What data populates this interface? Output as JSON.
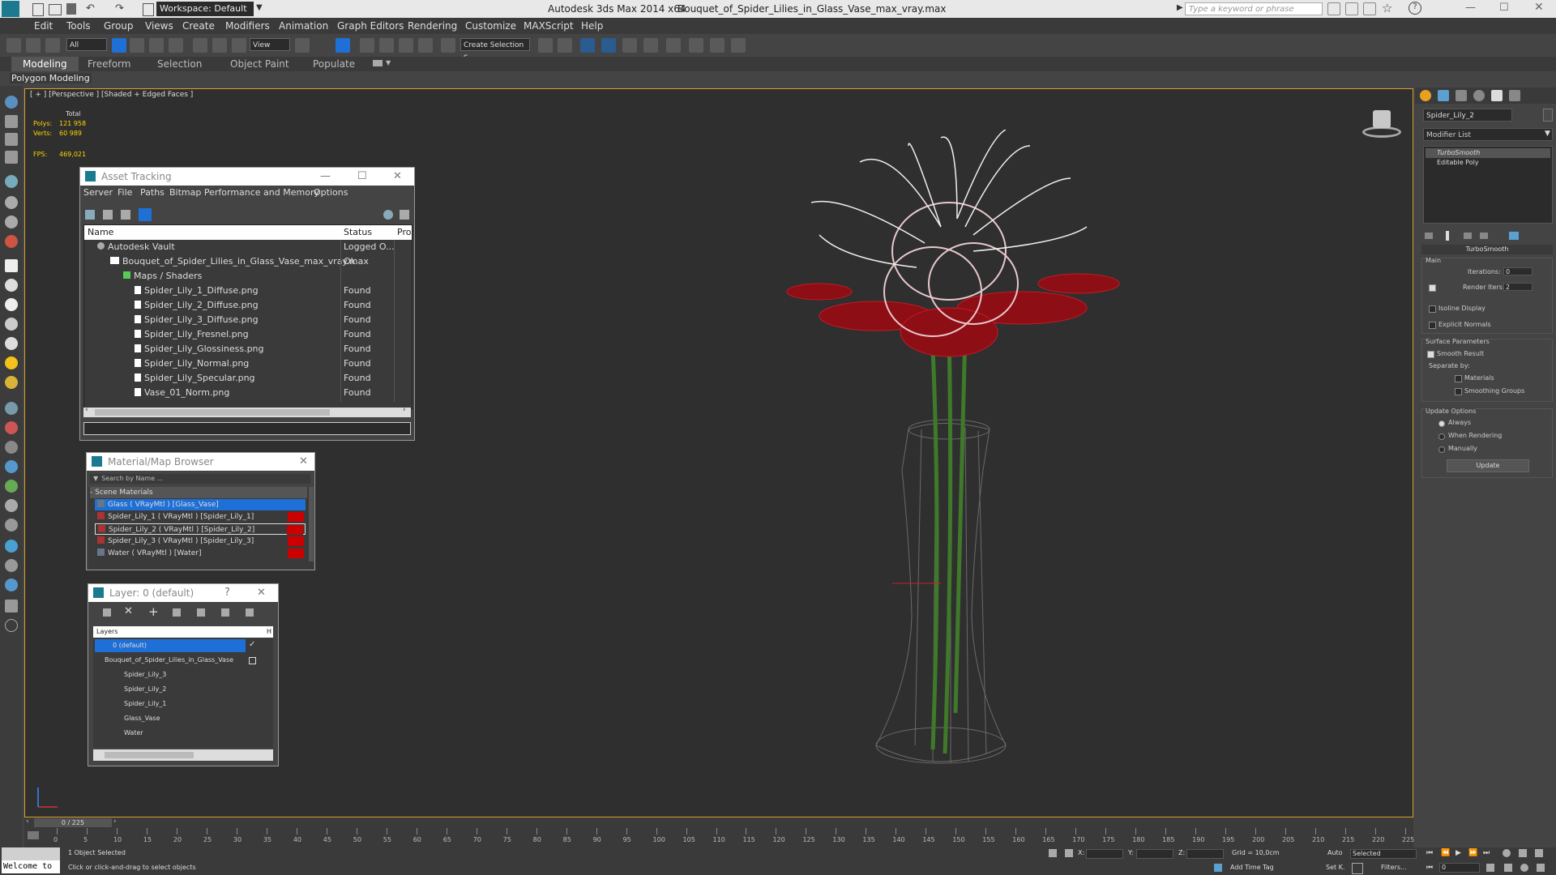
{
  "title_bar": {
    "workspace": "Workspace: Default",
    "app_title": "Autodesk 3ds Max  2014 x64",
    "file_title": "Bouquet_of_Spider_Lilies_in_Glass_Vase_max_vray.max",
    "search_placeholder": "Type a keyword or phrase"
  },
  "menu": [
    "Edit",
    "Tools",
    "Group",
    "Views",
    "Create",
    "Modifiers",
    "Animation",
    "Graph Editors",
    "Rendering",
    "Customize",
    "MAXScript",
    "Help"
  ],
  "toolbar": {
    "selection_filter": "All",
    "ref_coord": "View",
    "named_selection": "Create Selection S"
  },
  "ribbon": {
    "tabs": [
      "Modeling",
      "Freeform",
      "Selection",
      "Object Paint",
      "Populate"
    ],
    "sub_label": "Polygon Modeling"
  },
  "viewport": {
    "label": "[ + ] [Perspective ] [Shaded + Edged Faces ]",
    "stats_total": "Total",
    "polys_label": "Polys:",
    "polys_value": "121 958",
    "verts_label": "Verts:",
    "verts_value": "60 989",
    "fps_label": "FPS:",
    "fps_value": "469,021"
  },
  "asset_tracking": {
    "title": "Asset Tracking",
    "menu": [
      "Server",
      "File",
      "Paths",
      "Bitmap Performance and Memory",
      "Options"
    ],
    "columns": [
      "Name",
      "Status",
      "Pro:"
    ],
    "rows": [
      {
        "name": "Autodesk Vault",
        "status": "Logged O..."
      },
      {
        "name": "Bouquet_of_Spider_Lilies_in_Glass_Vase_max_vray.max",
        "status": "Ok"
      },
      {
        "name": "Maps / Shaders",
        "status": ""
      },
      {
        "name": "Spider_Lily_1_Diffuse.png",
        "status": "Found"
      },
      {
        "name": "Spider_Lily_2_Diffuse.png",
        "status": "Found"
      },
      {
        "name": "Spider_Lily_3_Diffuse.png",
        "status": "Found"
      },
      {
        "name": "Spider_Lily_Fresnel.png",
        "status": "Found"
      },
      {
        "name": "Spider_Lily_Glossiness.png",
        "status": "Found"
      },
      {
        "name": "Spider_Lily_Normal.png",
        "status": "Found"
      },
      {
        "name": "Spider_Lily_Specular.png",
        "status": "Found"
      },
      {
        "name": "Vase_01_Norm.png",
        "status": "Found"
      }
    ]
  },
  "material_browser": {
    "title": "Material/Map Browser",
    "search_placeholder": "Search by Name ...",
    "group": "- Scene Materials",
    "items": [
      "Glass  ( VRayMtl ) [Glass_Vase]",
      "Spider_Lily_1  ( VRayMtl ) [Spider_Lily_1]",
      "Spider_Lily_2  ( VRayMtl ) [Spider_Lily_2]",
      "Spider_Lily_3  ( VRayMtl ) [Spider_Lily_3]",
      "Water  ( VRayMtl ) [Water]"
    ]
  },
  "layer_window": {
    "title": "Layer: 0 (default)",
    "help": "?",
    "header": "Layers",
    "header_col": "H",
    "rows": [
      "0 (default)",
      "Bouquet_of_Spider_Lilies_in_Glass_Vase",
      "Spider_Lily_3",
      "Spider_Lily_2",
      "Spider_Lily_1",
      "Glass_Vase",
      "Water"
    ]
  },
  "command_panel": {
    "object_name": "Spider_Lily_2",
    "modifier_list": "Modifier List",
    "stack": [
      "TurboSmooth",
      "Editable Poly"
    ],
    "rollout_title": "TurboSmooth",
    "main_label": "Main",
    "iterations_label": "Iterations:",
    "iterations_value": "0",
    "render_iters_label": "Render Iters:",
    "render_iters_value": "2",
    "isoline": "Isoline Display",
    "explicit_normals": "Explicit Normals",
    "surface_params": "Surface Parameters",
    "smooth_result": "Smooth Result",
    "separate_by": "Separate by:",
    "materials": "Materials",
    "smoothing_groups": "Smoothing Groups",
    "update_options": "Update Options",
    "always": "Always",
    "when_rendering": "When Rendering",
    "manually": "Manually",
    "update_button": "Update"
  },
  "timeline": {
    "frame": "0 / 225",
    "ticks": [
      "0",
      "5",
      "10",
      "15",
      "20",
      "25",
      "30",
      "35",
      "40",
      "45",
      "50",
      "55",
      "60",
      "65",
      "70",
      "75",
      "80",
      "85",
      "90",
      "95",
      "100",
      "105",
      "110",
      "115",
      "120",
      "125",
      "130",
      "135",
      "140",
      "145",
      "150",
      "155",
      "160",
      "165",
      "170",
      "175",
      "180",
      "185",
      "190",
      "195",
      "200",
      "205",
      "210",
      "215",
      "220",
      "225"
    ]
  },
  "status": {
    "listener": "Welcome to",
    "selection": "1 Object Selected",
    "prompt": "Click or click-and-drag to select objects",
    "x_label": "X:",
    "y_label": "Y:",
    "z_label": "Z:",
    "grid": "Grid = 10,0cm",
    "add_time_tag": "Add Time Tag",
    "auto": "Auto",
    "set_key": "Set K.",
    "selected": "Selected",
    "filters": "Filters...",
    "frame_field": "0"
  },
  "colors": {
    "viewport_border": "#d7a02a",
    "selection_blue": "#1e6fd6",
    "lily_red": "#b3141c"
  }
}
